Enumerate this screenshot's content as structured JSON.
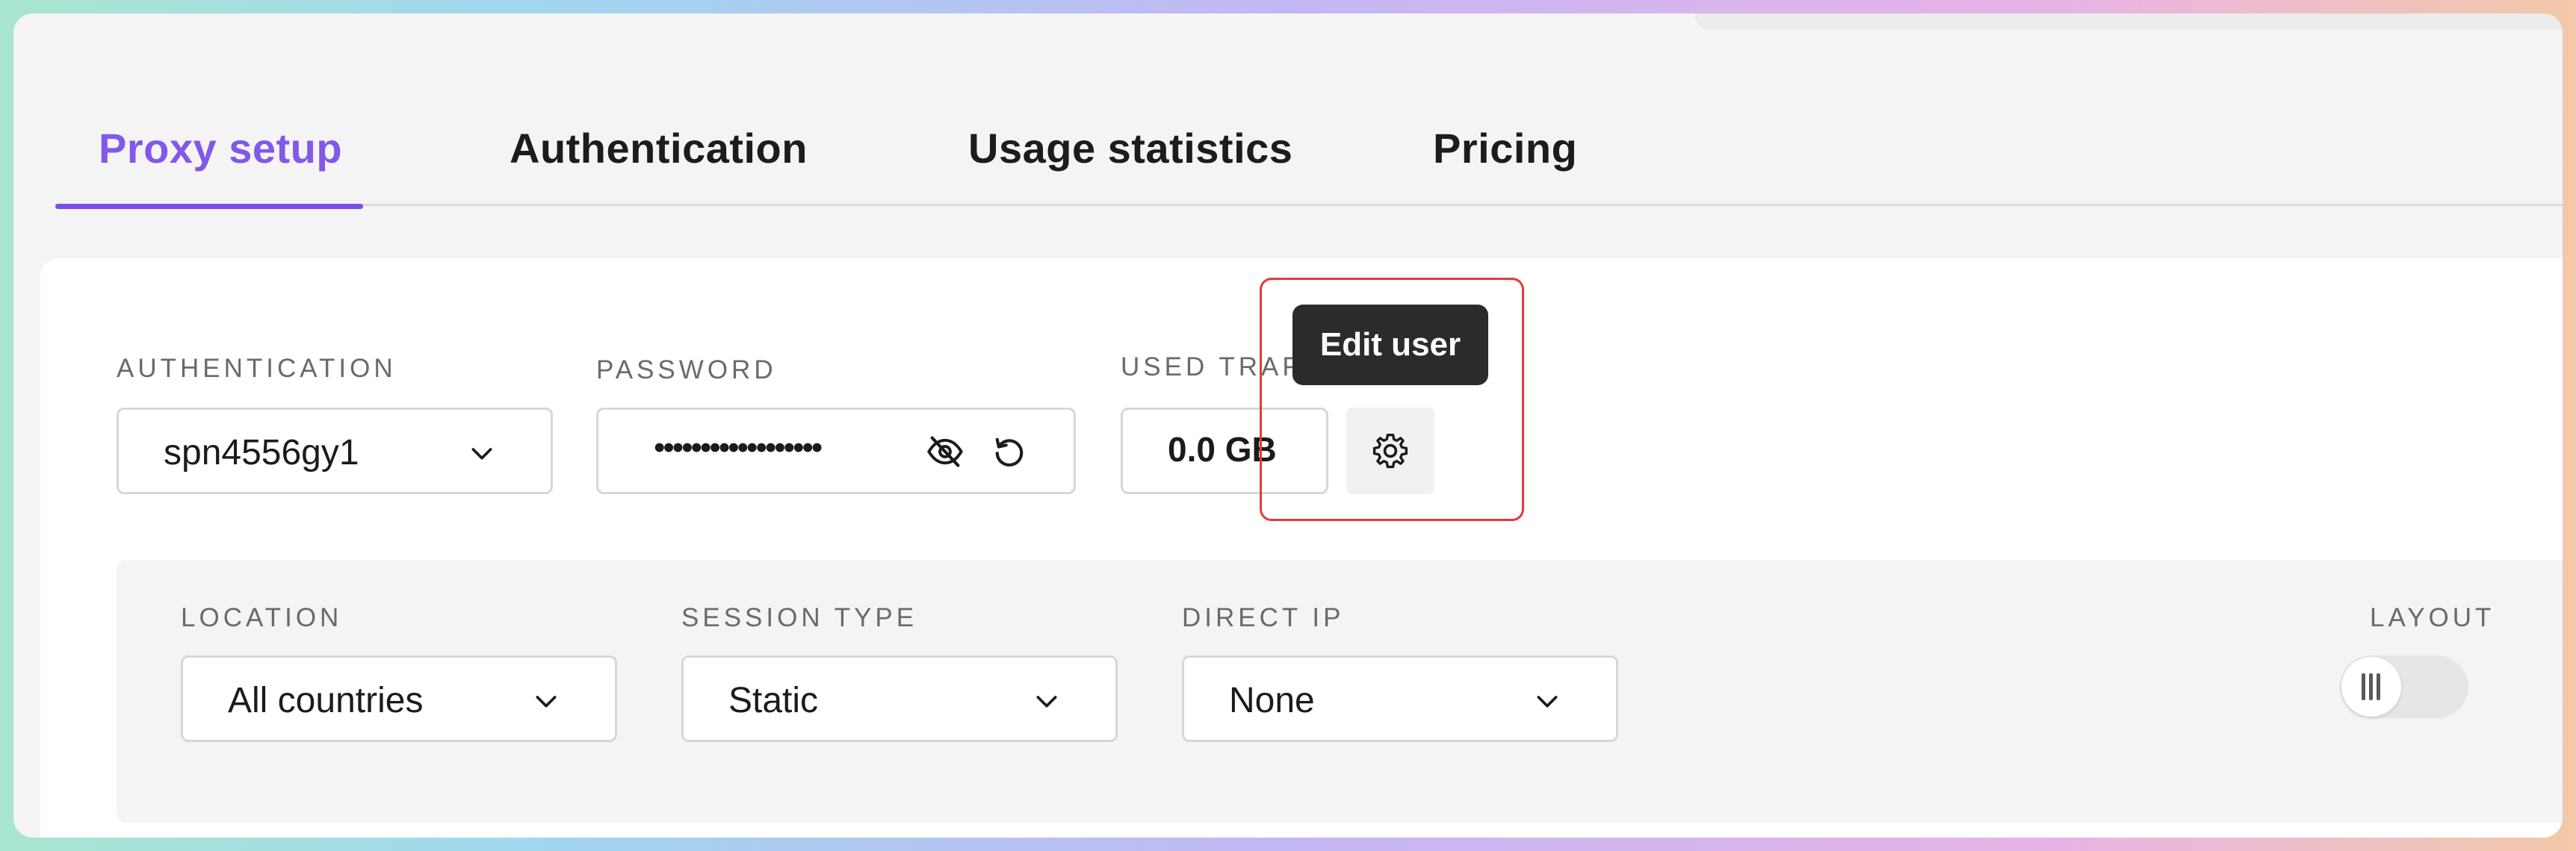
{
  "tabs": [
    {
      "label": "Proxy setup",
      "active": true
    },
    {
      "label": "Authentication",
      "active": false
    },
    {
      "label": "Usage statistics",
      "active": false
    },
    {
      "label": "Pricing",
      "active": false
    }
  ],
  "auth": {
    "label": "AUTHENTICATION",
    "value": "spn4556gy1"
  },
  "password": {
    "label": "PASSWORD",
    "masked_value": "••••••••••••••••••"
  },
  "traffic": {
    "label": "USED TRAFFIC",
    "value": "0.0 GB"
  },
  "tooltip": {
    "text": "Edit user"
  },
  "options": {
    "location": {
      "label": "LOCATION",
      "value": "All countries"
    },
    "session_type": {
      "label": "SESSION TYPE",
      "value": "Static"
    },
    "direct_ip": {
      "label": "DIRECT IP",
      "value": "None"
    },
    "layout": {
      "label": "LAYOUT",
      "enabled": false
    }
  },
  "icons": {
    "password_visibility": "eye-off-icon",
    "password_regenerate": "refresh-icon",
    "edit_user": "gear-icon",
    "dropdown": "chevron-down-icon"
  },
  "colors": {
    "accent": "#7b4fe6",
    "highlight": "#e23b3b",
    "tooltip_bg": "#2b2b2b"
  }
}
